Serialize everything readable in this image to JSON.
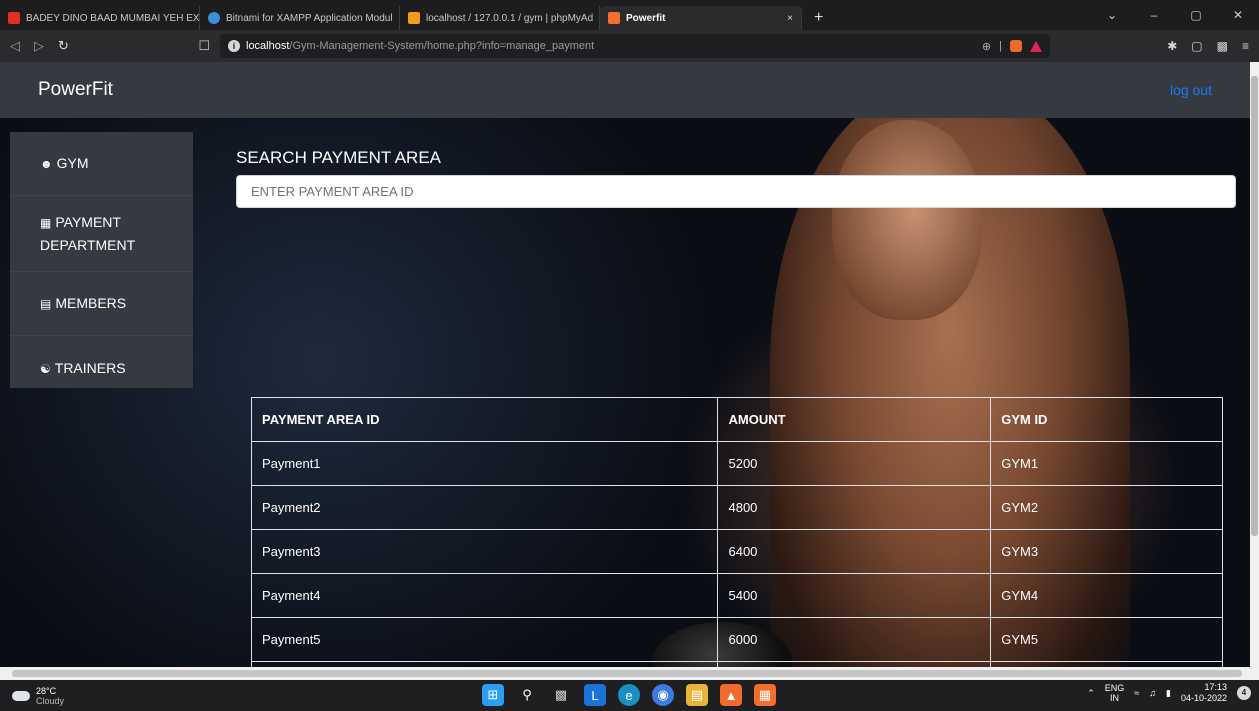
{
  "browser": {
    "tabs": [
      {
        "title": "BADEY DINO BAAD MUMBAI YEH EXP",
        "favicon_color": "#e52d27",
        "active": false
      },
      {
        "title": "Bitnami for XAMPP Application Modul",
        "favicon_color": "#3b8fd4",
        "active": false
      },
      {
        "title": "localhost / 127.0.0.1 / gym | phpMyAd",
        "favicon_color": "#f29b1d",
        "active": false
      },
      {
        "title": "Powerfit",
        "favicon_color": "#f36f2b",
        "active": true
      }
    ],
    "tab_close": "×",
    "new_tab": "+",
    "url_host": "localhost",
    "url_path": "/Gym-Management-System/home.php?info=manage_payment"
  },
  "app": {
    "brand": "PowerFit",
    "logout": "log out",
    "accent_color": "#1a7cf5"
  },
  "sidebar": {
    "items": [
      {
        "label": "GYM",
        "icon": "user-icon"
      },
      {
        "label": "PAYMENT DEPARTMENT",
        "icon": "cashier-icon"
      },
      {
        "label": "MEMBERS",
        "icon": "list-icon"
      },
      {
        "label": "TRAINERS",
        "icon": "users-icon"
      }
    ]
  },
  "search": {
    "title": "SEARCH PAYMENT AREA",
    "placeholder": "ENTER PAYMENT AREA ID"
  },
  "table": {
    "headers": [
      "PAYMENT AREA ID",
      "AMOUNT",
      "GYM ID"
    ],
    "rows": [
      [
        "Payment1",
        "5200",
        "GYM1"
      ],
      [
        "Payment2",
        "4800",
        "GYM2"
      ],
      [
        "Payment3",
        "6400",
        "GYM3"
      ],
      [
        "Payment4",
        "5400",
        "GYM4"
      ],
      [
        "Payment5",
        "6000",
        "GYM5"
      ]
    ]
  },
  "taskbar": {
    "weather_temp": "28°C",
    "weather_desc": "Cloudy",
    "lang_top": "ENG",
    "lang_bottom": "IN",
    "time": "17:13",
    "date": "04-10-2022",
    "notifications": "4"
  }
}
